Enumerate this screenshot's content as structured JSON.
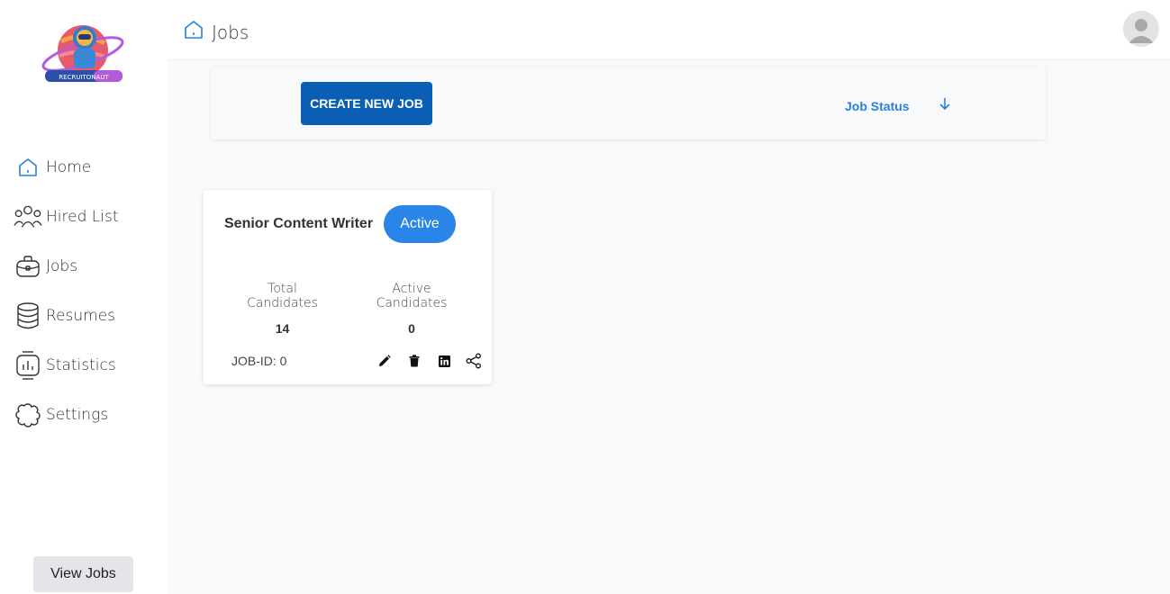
{
  "app": {
    "logo_text": "RECRUITONAUT"
  },
  "sidebar": {
    "items": [
      {
        "label": "Home",
        "icon": "home-icon"
      },
      {
        "label": "Hired List",
        "icon": "people-icon"
      },
      {
        "label": "Jobs",
        "icon": "briefcase-icon"
      },
      {
        "label": "Resumes",
        "icon": "database-icon"
      },
      {
        "label": "Statistics",
        "icon": "statistics-icon"
      },
      {
        "label": "Settings",
        "icon": "settings-icon"
      }
    ],
    "view_jobs_label": "View Jobs"
  },
  "header": {
    "title": "Jobs",
    "icon": "home-icon"
  },
  "toolbar": {
    "create_label": "CREATE NEW JOB",
    "status_label": "Job Status",
    "status_icon": "arrow-down-icon"
  },
  "job_card": {
    "title": "Senior Content Writer",
    "status": "Active",
    "total_label": "Total Candidates",
    "total_value": "14",
    "active_label": "Active Candidates",
    "active_value": "0",
    "job_id": "JOB-ID: 0"
  },
  "colors": {
    "primary": "#0a5fb4",
    "accent": "#2a85e8",
    "link": "#2a7fd8"
  }
}
